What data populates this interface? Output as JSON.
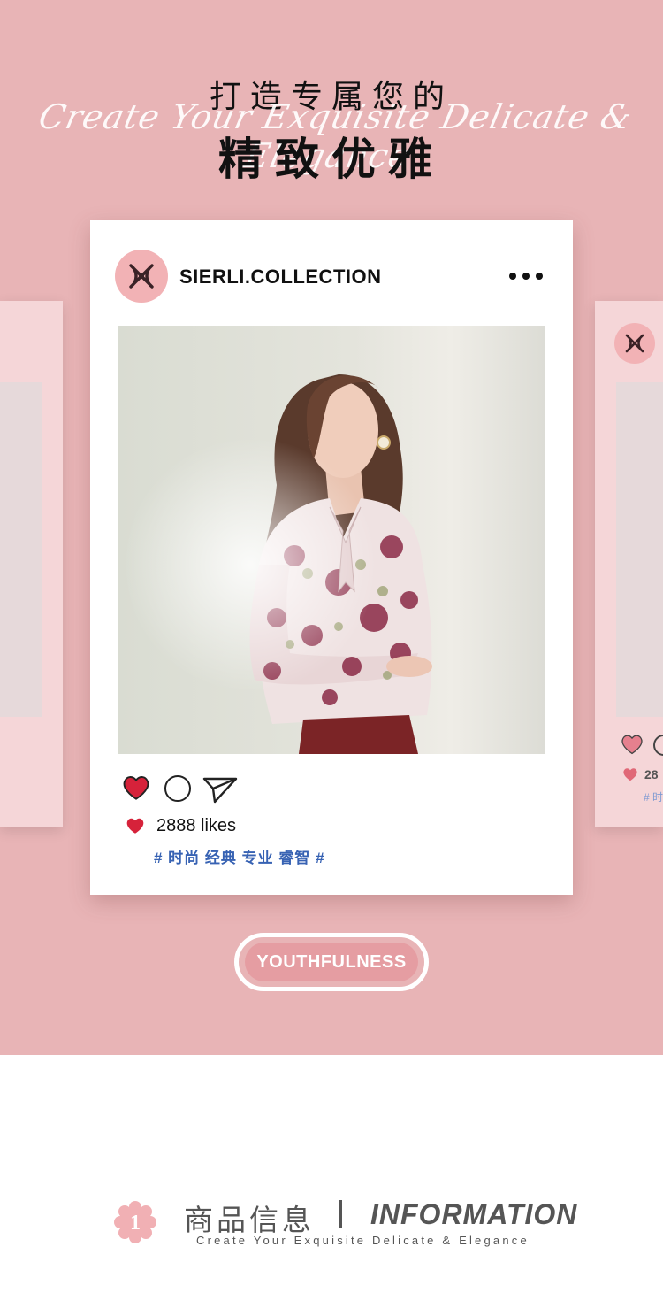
{
  "header": {
    "title_line1": "打造专属您的",
    "script_text": "Create Your Exquisite Delicate & Elegance",
    "title_line2": "精致优雅"
  },
  "post": {
    "account_name": "SIERLI.COLLECTION",
    "likes_text": "2888 likes",
    "hashtags": "# 时尚 经典 专业 睿智 #"
  },
  "side_card_right": {
    "likes_partial": "28",
    "tag_partial": "# 时"
  },
  "youth_button": {
    "label": "YOUTHFULNESS"
  },
  "info_section": {
    "badge_number": "1",
    "title_cn": "商品信息",
    "title_en": "INFORMATION",
    "subtitle": "Create Your Exquisite Delicate & Elegance"
  },
  "colors": {
    "background_pink": "#e8b4b6",
    "heart_red": "#d6223a",
    "hashtag_blue": "#3762b3",
    "button_pink": "#e59da2"
  }
}
